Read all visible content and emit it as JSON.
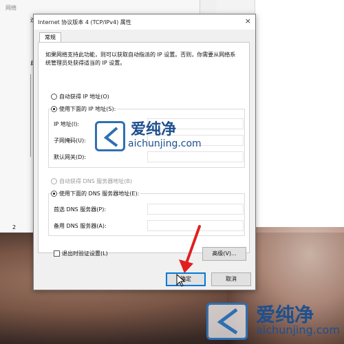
{
  "dialog": {
    "title": "Internet 协议版本 4 (TCP/IPv4) 属性",
    "close_glyph": "×",
    "tab_general": "常规",
    "description": "如果网络支持此功能，则可以获取自动指派的 IP 设置。否则，你需要从网络系统管理员处获得适当的 IP 设置。",
    "ip_auto_label": "自动获得 IP 地址(O)",
    "ip_manual_label": "使用下面的 IP 地址(S):",
    "ip_address_label": "IP 地址(I):",
    "subnet_label": "子网掩码(U):",
    "gateway_label": "默认网关(D):",
    "dns_auto_label": "自动获得 DNS 服务器地址(B)",
    "dns_manual_label": "使用下面的 DNS 服务器地址(E):",
    "preferred_dns_label": "首选 DNS 服务器(P):",
    "alternate_dns_label": "备用 DNS 服务器(A):",
    "validate_label": "退出时验证设置(L)",
    "advanced_button": "高级(V)...",
    "ok_button": "确定",
    "cancel_button": "取消"
  },
  "background": {
    "left_char_1": "网络",
    "left_char_2": "连",
    "left_char_3": "此",
    "left_number": "2"
  },
  "watermark": {
    "title": "爱纯净",
    "url": "aichunjing.com"
  },
  "colors": {
    "accent": "#0078d7",
    "arrow": "#e02020",
    "watermark": "#1e4f8e"
  }
}
